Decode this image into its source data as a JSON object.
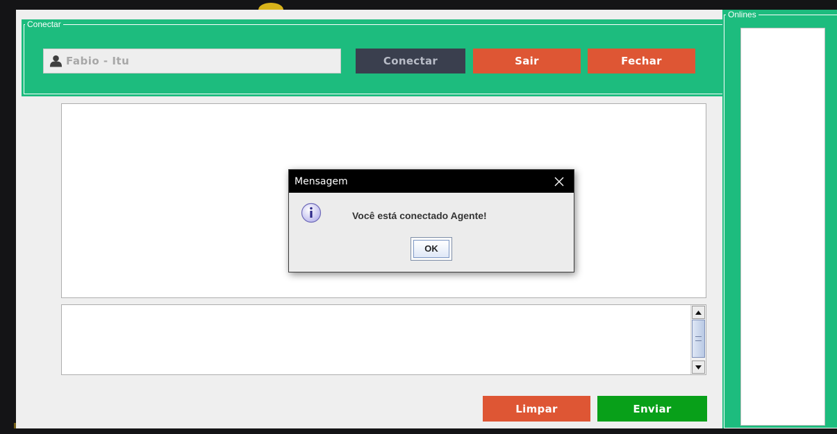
{
  "connect_group": {
    "title": "Conectar",
    "username_value": "Fabio - Itu",
    "connect_label": "Conectar",
    "logout_label": "Sair",
    "close_label": "Fechar"
  },
  "online_group": {
    "title": "Onlines",
    "users": []
  },
  "chat": {
    "history_text": "",
    "message_text": "",
    "clear_label": "Limpar",
    "send_label": "Enviar"
  },
  "dialog": {
    "title": "Mensagem",
    "message": "Você está conectado Agente!",
    "ok_label": "OK",
    "icon": "info-icon"
  },
  "colors": {
    "panel_green": "#1dbc7e",
    "button_red": "#de5634",
    "button_dark": "#3a3f4e",
    "button_green": "#08a019"
  }
}
